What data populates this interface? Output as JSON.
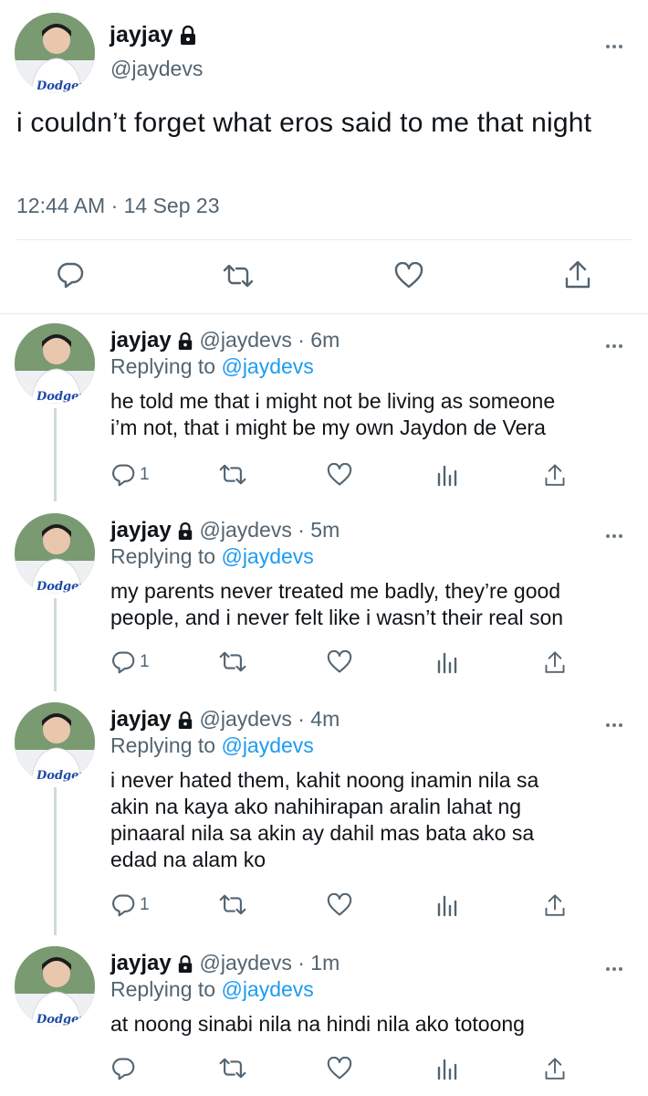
{
  "main_tweet": {
    "name": "jayjay",
    "handle": "@jaydevs",
    "text": "i couldn’t forget what eros said to me that night",
    "timestamp": "12:44 AM · 14 Sep 23"
  },
  "avatar": {
    "jersey_text": "Dodgers"
  },
  "replies": [
    {
      "name": "jayjay",
      "handle": "@jaydevs",
      "time": "· 6m",
      "replying_prefix": "Replying to",
      "replying_handle": "@jaydevs",
      "text_lines": [
        "he told me that i might not be living as someone",
        "i’m not, that i might be my own Jaydon de Vera"
      ],
      "reply_count": "1"
    },
    {
      "name": "jayjay",
      "handle": "@jaydevs",
      "time": "· 5m",
      "replying_prefix": "Replying to",
      "replying_handle": "@jaydevs",
      "text_lines": [
        "my parents never treated me badly, they’re good",
        "people, and i never felt like i wasn’t their real son"
      ],
      "reply_count": "1"
    },
    {
      "name": "jayjay",
      "handle": "@jaydevs",
      "time": "· 4m",
      "replying_prefix": "Replying to",
      "replying_handle": "@jaydevs",
      "text_lines": [
        "i never hated them, kahit noong inamin nila sa",
        "akin na kaya ako nahihirapan aralin lahat ng",
        "pinaaral nila sa akin ay dahil mas bata ako sa",
        "edad na alam ko"
      ],
      "reply_count": "1"
    },
    {
      "name": "jayjay",
      "handle": "@jaydevs",
      "time": "· 1m",
      "replying_prefix": "Replying to",
      "replying_handle": "@jaydevs",
      "text_lines": [
        "at noong sinabi nila na hindi nila ako totoong"
      ],
      "reply_count": ""
    }
  ],
  "colors": {
    "accent": "#1d9bf0",
    "secondary_text": "#536471",
    "divider": "#e6ecf0"
  },
  "icons": [
    "lock-icon",
    "more-icon",
    "reply-icon",
    "retweet-icon",
    "like-icon",
    "views-icon",
    "share-icon"
  ]
}
